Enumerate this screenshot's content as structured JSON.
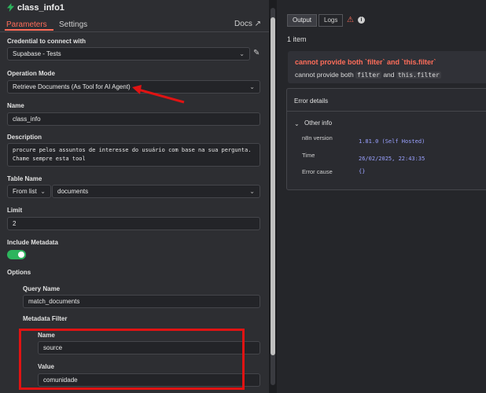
{
  "header": {
    "node_title": "class_info1",
    "tabs": [
      "Parameters",
      "Settings"
    ],
    "docs": "Docs"
  },
  "params": {
    "credential_label": "Credential to connect with",
    "credential_value": "Supabase - Tests",
    "operation_label": "Operation Mode",
    "operation_value": "Retrieve Documents (As Tool for AI Agent)",
    "name_label": "Name",
    "name_value": "class_info",
    "description_label": "Description",
    "description_line1": "procure pelos assuntos de interesse do usuário com base na sua pergunta.",
    "description_line2": "Chame sempre esta tool",
    "table_label": "Table Name",
    "table_mode": "From list",
    "table_value": "documents",
    "limit_label": "Limit",
    "limit_value": "2",
    "metadata_label": "Include Metadata",
    "options_label": "Options",
    "query_label": "Query Name",
    "query_value": "match_documents",
    "filter_label": "Metadata Filter",
    "filter_name_label": "Name",
    "filter_name_value": "source",
    "filter_value_label": "Value",
    "filter_value_value": "comunidade"
  },
  "output": {
    "tabs": [
      "Output",
      "Logs"
    ],
    "count": "1 item",
    "error_title": "cannot provide both `filter` and `this.filter`",
    "error_sub_prefix": "cannot provide both",
    "error_code1": "filter",
    "error_and": "and",
    "error_code2": "this.filter",
    "details_label": "Error details",
    "other_info": "Other info",
    "n8n_label": "n8n version",
    "n8n_value": "1.81.0 (Self Hosted)",
    "time_label": "Time",
    "time_value": "26/02/2025, 22:43:35",
    "cause_label": "Error cause",
    "cause_value": "{}"
  },
  "colors": {
    "accent": "#ff6d5a",
    "error": "#ff6d5a",
    "highlight": "#e01313",
    "toggle": "#2db55d"
  }
}
